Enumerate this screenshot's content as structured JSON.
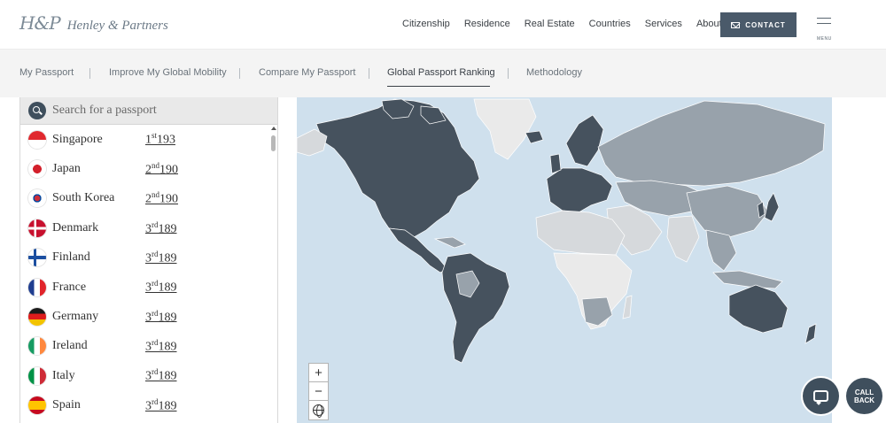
{
  "brand": {
    "mark": "H&P",
    "name": "Henley & Partners"
  },
  "header": {
    "nav": [
      "Citizenship",
      "Residence",
      "Real Estate",
      "Countries",
      "Services",
      "About"
    ],
    "contact_label": "CONTACT",
    "menu_label": "MENU"
  },
  "subnav": {
    "tabs": [
      "My Passport",
      "Improve My Global Mobility",
      "Compare My Passport",
      "Global Passport Ranking",
      "Methodology"
    ],
    "active": "Global Passport Ranking"
  },
  "search": {
    "placeholder": "Search for a passport"
  },
  "ranking": [
    {
      "country": "Singapore",
      "rank_num": "1",
      "rank_suffix": "st",
      "score": "193",
      "flag": "singapore-flag"
    },
    {
      "country": "Japan",
      "rank_num": "2",
      "rank_suffix": "nd",
      "score": "190",
      "flag": "japan-flag"
    },
    {
      "country": "South Korea",
      "rank_num": "2",
      "rank_suffix": "nd",
      "score": "190",
      "flag": "south-korea-flag"
    },
    {
      "country": "Denmark",
      "rank_num": "3",
      "rank_suffix": "rd",
      "score": "189",
      "flag": "denmark-flag"
    },
    {
      "country": "Finland",
      "rank_num": "3",
      "rank_suffix": "rd",
      "score": "189",
      "flag": "finland-flag"
    },
    {
      "country": "France",
      "rank_num": "3",
      "rank_suffix": "rd",
      "score": "189",
      "flag": "france-flag"
    },
    {
      "country": "Germany",
      "rank_num": "3",
      "rank_suffix": "rd",
      "score": "189",
      "flag": "germany-flag"
    },
    {
      "country": "Ireland",
      "rank_num": "3",
      "rank_suffix": "rd",
      "score": "189",
      "flag": "ireland-flag"
    },
    {
      "country": "Italy",
      "rank_num": "3",
      "rank_suffix": "rd",
      "score": "189",
      "flag": "italy-flag"
    },
    {
      "country": "Spain",
      "rank_num": "3",
      "rank_suffix": "rd",
      "score": "189",
      "flag": "spain-flag"
    }
  ],
  "map": {
    "zoom_in": "+",
    "zoom_out": "−",
    "colors": {
      "ocean": "#cfe0ed",
      "visa_free": "#46525e",
      "visa_required": "#98a2ab",
      "other": "#d6d9dc",
      "neutral": "#eaeaea"
    }
  },
  "floating": {
    "chat_icon": "chat-icon",
    "callback_label": "CALL BACK"
  },
  "colors": {
    "brand_dark": "#4a5a6a",
    "accent_button": "#3f4f5d"
  }
}
